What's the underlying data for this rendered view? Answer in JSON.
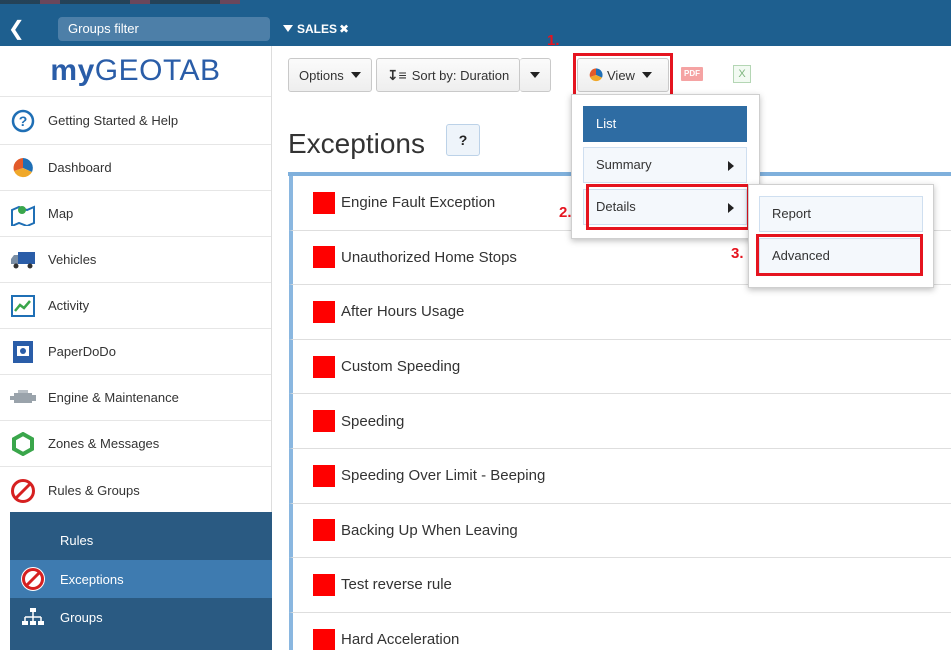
{
  "topbar": {
    "groups_filter_label": "Groups filter",
    "active_group": "SALES"
  },
  "sidebar": {
    "logo_my": "my",
    "logo_geotab": "GEOTAB",
    "items": [
      {
        "label": "Getting Started & Help",
        "icon": "help-circle-icon"
      },
      {
        "label": "Dashboard",
        "icon": "pie-chart-icon"
      },
      {
        "label": "Map",
        "icon": "map-icon"
      },
      {
        "label": "Vehicles",
        "icon": "truck-icon"
      },
      {
        "label": "Activity",
        "icon": "activity-chart-icon"
      },
      {
        "label": "PaperDoDo",
        "icon": "document-icon"
      },
      {
        "label": "Engine & Maintenance",
        "icon": "engine-icon"
      },
      {
        "label": "Zones & Messages",
        "icon": "zone-icon"
      },
      {
        "label": "Rules & Groups",
        "icon": "prohibited-icon"
      }
    ],
    "sub_items": [
      {
        "label": "Rules"
      },
      {
        "label": "Exceptions"
      },
      {
        "label": "Groups"
      }
    ]
  },
  "toolbar": {
    "options_label": "Options",
    "sort_label": "Sort by: Duration",
    "view_label": "View",
    "pdf_label": "PDF",
    "excel_label": "X"
  },
  "steps": {
    "step1": "1.",
    "step2": "2.",
    "step3": "3."
  },
  "main": {
    "title": "Exceptions",
    "help_label": "?",
    "exceptions": [
      "Engine Fault Exception",
      "Unauthorized Home Stops",
      "After Hours Usage",
      "Custom Speeding",
      "Speeding",
      "Speeding Over Limit - Beeping",
      "Backing Up When Leaving",
      "Test reverse rule",
      "Hard Acceleration"
    ]
  },
  "view_menu": {
    "items": [
      "List",
      "Summary",
      "Details"
    ],
    "selected": "List"
  },
  "details_submenu": {
    "items": [
      "Report",
      "Advanced"
    ]
  },
  "colors": {
    "topbar": "#1e5f8f",
    "accent": "#2e6ca3",
    "highlight_box": "#e5141f",
    "exception_square": "#ff0000"
  }
}
